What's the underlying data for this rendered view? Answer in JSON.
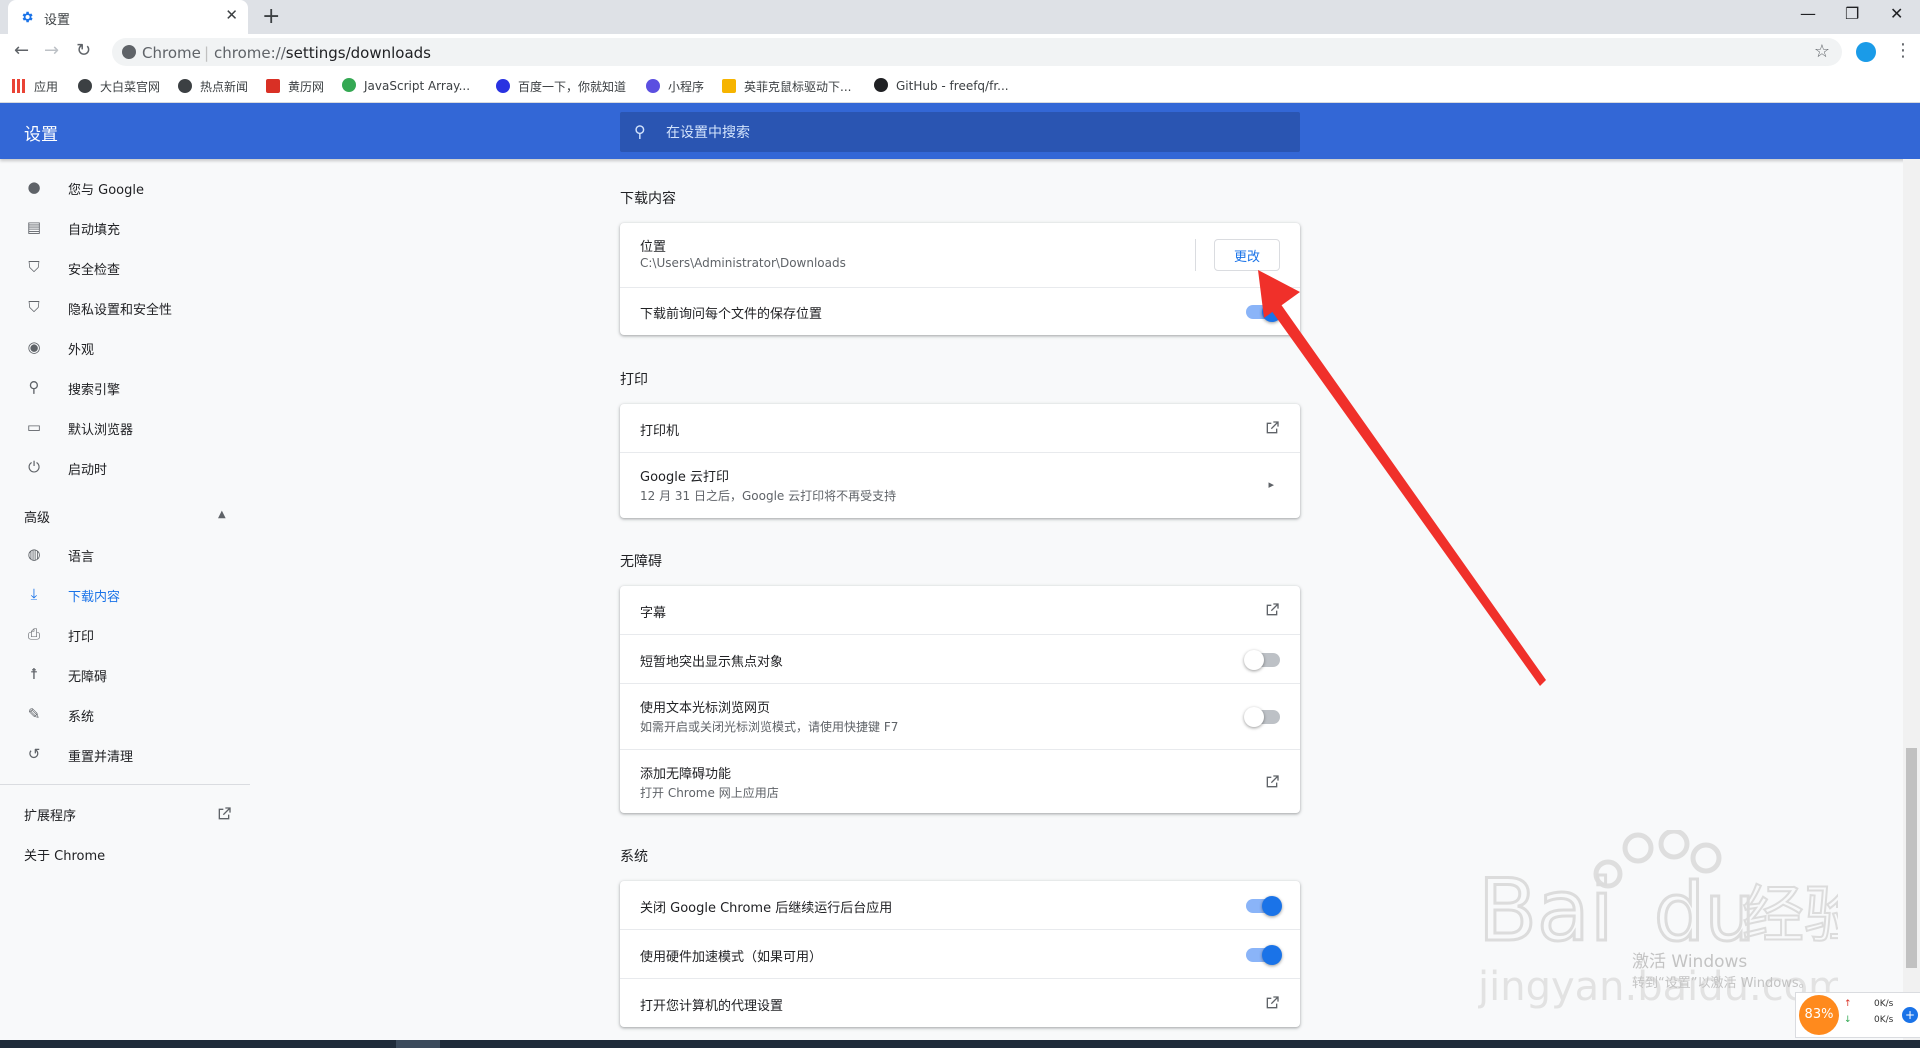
{
  "browser": {
    "tab_title": "设置",
    "new_tab": "+",
    "tab_close": "✕",
    "window_minimize": "—",
    "window_restore": "❐",
    "window_close": "✕",
    "omnibox_chrome": "Chrome",
    "omnibox_sep": "|",
    "url_prefix": "chrome://",
    "url_path": "settings/downloads",
    "bookmarks": [
      {
        "label": "应用",
        "icon": "apps-icon",
        "color": "#ea4335"
      },
      {
        "label": "大白菜官网",
        "icon": "globe-icon",
        "color": "#3c4043"
      },
      {
        "label": "热点新闻",
        "icon": "globe-icon",
        "color": "#3c4043"
      },
      {
        "label": "黄历网",
        "icon": "calendar-icon",
        "color": "#d93025"
      },
      {
        "label": "JavaScript Array...",
        "icon": "site-icon",
        "color": "#34a853"
      },
      {
        "label": "百度一下，你就知道",
        "icon": "paw-icon",
        "color": "#2932e1"
      },
      {
        "label": "小程序",
        "icon": "link-icon",
        "color": "#5b4fe0"
      },
      {
        "label": "英菲克鼠标驱动下...",
        "icon": "trophy-icon",
        "color": "#f6b400"
      },
      {
        "label": "GitHub - freefq/fr...",
        "icon": "github-icon",
        "color": "#202124"
      }
    ]
  },
  "header": {
    "title": "设置",
    "search_placeholder": "在设置中搜索"
  },
  "sidebar": {
    "items": [
      {
        "label": "您与 Google",
        "icon": "person-icon",
        "glyph": "●"
      },
      {
        "label": "自动填充",
        "icon": "clipboard-icon",
        "glyph": "▤"
      },
      {
        "label": "安全检查",
        "icon": "shield-check-icon",
        "glyph": "⛉"
      },
      {
        "label": "隐私设置和安全性",
        "icon": "shield-icon",
        "glyph": "⛉"
      },
      {
        "label": "外观",
        "icon": "palette-icon",
        "glyph": "◉"
      },
      {
        "label": "搜索引擎",
        "icon": "search-icon",
        "glyph": "⚲"
      },
      {
        "label": "默认浏览器",
        "icon": "browser-icon",
        "glyph": "▭"
      },
      {
        "label": "启动时",
        "icon": "power-icon",
        "glyph": "⏻"
      }
    ],
    "advanced_label": "高级",
    "advanced_items": [
      {
        "label": "语言",
        "icon": "globe-icon",
        "glyph": "◍"
      },
      {
        "label": "下载内容",
        "icon": "download-icon",
        "glyph": "⤓"
      },
      {
        "label": "打印",
        "icon": "printer-icon",
        "glyph": "⎙"
      },
      {
        "label": "无障碍",
        "icon": "accessibility-icon",
        "glyph": "☨"
      },
      {
        "label": "系统",
        "icon": "wrench-icon",
        "glyph": "✎"
      },
      {
        "label": "重置并清理",
        "icon": "history-icon",
        "glyph": "↺"
      }
    ],
    "active": "下载内容",
    "extensions_label": "扩展程序",
    "about_label": "关于 Chrome"
  },
  "downloads": {
    "section_title": "下载内容",
    "location_label": "位置",
    "location_path": "C:\\Users\\Administrator\\Downloads",
    "change_button": "更改",
    "ask_label": "下载前询问每个文件的保存位置",
    "ask_enabled": true
  },
  "printing": {
    "section_title": "打印",
    "printers_label": "打印机",
    "cloud_print_label": "Google 云打印",
    "cloud_print_sub": "12 月 31 日之后，Google 云打印将不再受支持"
  },
  "accessibility": {
    "section_title": "无障碍",
    "captions_label": "字幕",
    "focus_highlight_label": "短暂地突出显示焦点对象",
    "focus_highlight_enabled": false,
    "caret_label": "使用文本光标浏览网页",
    "caret_sub": "如需开启或关闭光标浏览模式，请使用快捷键 F7",
    "caret_enabled": false,
    "add_features_label": "添加无障碍功能",
    "add_features_sub": "打开 Chrome 网上应用店"
  },
  "system": {
    "section_title": "系统",
    "background_label": "关闭 Google Chrome 后继续运行后台应用",
    "background_enabled": true,
    "hardware_label": "使用硬件加速模式（如果可用）",
    "hardware_enabled": true,
    "proxy_label": "打开您计算机的代理设置"
  },
  "overlay": {
    "activate_title": "激活 Windows",
    "activate_sub": "转到“设置”以激活 Windows。",
    "watermark_text": "Baidu经验",
    "watermark_sub": "jingyan.baidu.com",
    "net_percent": "83%",
    "net_up": "0K/s",
    "net_down": "0K/s",
    "arrow_color": "#f0302a"
  }
}
